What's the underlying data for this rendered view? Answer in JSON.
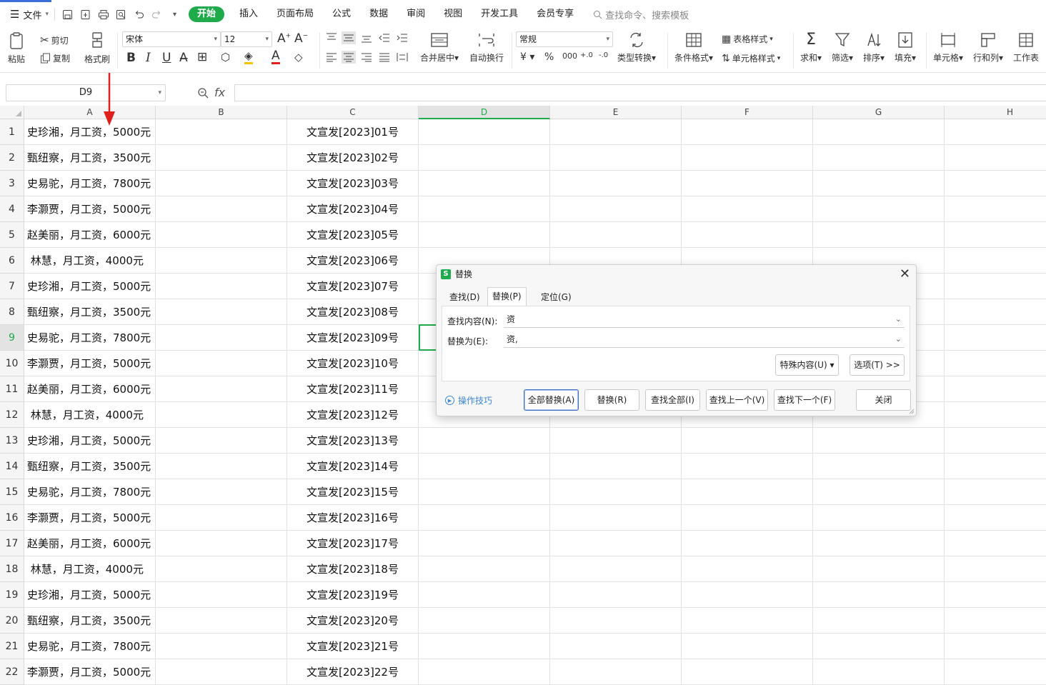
{
  "menu": {
    "file_label": "文件",
    "tabs": [
      "开始",
      "插入",
      "页面布局",
      "公式",
      "数据",
      "审阅",
      "视图",
      "开发工具",
      "会员专享"
    ],
    "search_placeholder": "查找命令、搜索模板"
  },
  "ribbon": {
    "paste": "粘贴",
    "cut": "剪切",
    "copy": "复制",
    "format_painter": "格式刷",
    "font_name": "宋体",
    "font_size": "12",
    "merge_center": "合并居中",
    "wrap_text": "自动换行",
    "number_format": "常规",
    "type_convert": "类型转换",
    "conditional_format": "条件格式",
    "table_style": "表格样式",
    "cell_style": "单元格样式",
    "sum": "求和",
    "filter": "筛选",
    "sort": "排序",
    "fill": "填充",
    "cells": "单元格",
    "row_col": "行和列",
    "worksheet": "工作表",
    "bold": "B",
    "italic": "I",
    "underline": "U",
    "font_color_glyph": "A"
  },
  "formula_bar": {
    "name_box": "D9",
    "fx_label": "fx",
    "content": ""
  },
  "grid": {
    "columns": [
      "A",
      "B",
      "C",
      "D",
      "E",
      "F",
      "G",
      "H"
    ],
    "selected_column": "D",
    "selected_row": "9",
    "rows": [
      {
        "n": "1",
        "a": "史珍湘，月工资，5000元",
        "c": "文宣发[2023]01号"
      },
      {
        "n": "2",
        "a": "甄纽察，月工资，3500元",
        "c": "文宣发[2023]02号"
      },
      {
        "n": "3",
        "a": "史易驼，月工资，7800元",
        "c": "文宣发[2023]03号"
      },
      {
        "n": "4",
        "a": "李灏贾，月工资，5000元",
        "c": "文宣发[2023]04号"
      },
      {
        "n": "5",
        "a": "赵美丽，月工资，6000元",
        "c": "文宣发[2023]05号"
      },
      {
        "n": "6",
        "a": " 林慧，月工资，4000元",
        "c": "文宣发[2023]06号"
      },
      {
        "n": "7",
        "a": "史珍湘，月工资，5000元",
        "c": "文宣发[2023]07号"
      },
      {
        "n": "8",
        "a": "甄纽察，月工资，3500元",
        "c": "文宣发[2023]08号"
      },
      {
        "n": "9",
        "a": "史易驼，月工资，7800元",
        "c": "文宣发[2023]09号"
      },
      {
        "n": "10",
        "a": "李灏贾，月工资，5000元",
        "c": "文宣发[2023]10号"
      },
      {
        "n": "11",
        "a": "赵美丽，月工资，6000元",
        "c": "文宣发[2023]11号"
      },
      {
        "n": "12",
        "a": " 林慧，月工资，4000元",
        "c": "文宣发[2023]12号"
      },
      {
        "n": "13",
        "a": "史珍湘，月工资，5000元",
        "c": "文宣发[2023]13号"
      },
      {
        "n": "14",
        "a": "甄纽察，月工资，3500元",
        "c": "文宣发[2023]14号"
      },
      {
        "n": "15",
        "a": "史易驼，月工资，7800元",
        "c": "文宣发[2023]15号"
      },
      {
        "n": "16",
        "a": "李灏贾，月工资，5000元",
        "c": "文宣发[2023]16号"
      },
      {
        "n": "17",
        "a": "赵美丽，月工资，6000元",
        "c": "文宣发[2023]17号"
      },
      {
        "n": "18",
        "a": " 林慧，月工资，4000元",
        "c": "文宣发[2023]18号"
      },
      {
        "n": "19",
        "a": "史珍湘，月工资，5000元",
        "c": "文宣发[2023]19号"
      },
      {
        "n": "20",
        "a": "甄纽察，月工资，3500元",
        "c": "文宣发[2023]20号"
      },
      {
        "n": "21",
        "a": "史易驼，月工资，7800元",
        "c": "文宣发[2023]21号"
      },
      {
        "n": "22",
        "a": "李灏贾，月工资，5000元",
        "c": "文宣发[2023]22号"
      }
    ]
  },
  "dialog": {
    "title": "替换",
    "logo": "S",
    "close_glyph": "✕",
    "tabs": [
      "查找(D)",
      "替换(P)",
      "定位(G)"
    ],
    "active_tab": "替换(P)",
    "find_label": "查找内容(N):",
    "find_value": "资",
    "replace_label": "替换为(E):",
    "replace_value": "资,",
    "special_button": "特殊内容(U) ▾",
    "options_button": "选项(T) >>",
    "tips_label": "操作技巧",
    "buttons": [
      "全部替换(A)",
      "替换(R)",
      "查找全部(I)",
      "查找上一个(V)",
      "查找下一个(F)",
      "关闭"
    ]
  },
  "colors": {
    "accent_green": "#1faa4b",
    "annotation_red": "#e0201c",
    "link_blue": "#3b86d6"
  }
}
